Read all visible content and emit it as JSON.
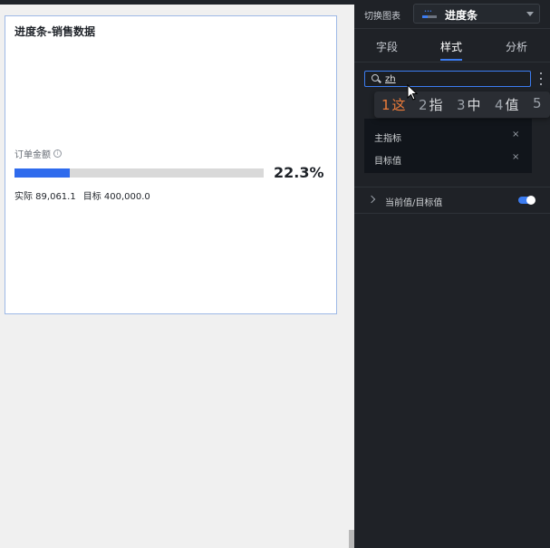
{
  "card": {
    "title": "进度条-销售数据",
    "metric_label": "订单金额",
    "info_glyph": "i",
    "progress_fraction": 0.223,
    "percent_text": "22.3%",
    "actual_text": "实际 89,061.1",
    "target_text": "目标 400,000.0",
    "colors": {
      "fill": "#2f6bed",
      "track": "#d9d9d9"
    }
  },
  "panel": {
    "switch_label": "切换图表",
    "chart_name": "进度条",
    "chart_icon": "progress-chart-icon",
    "tabs": [
      {
        "label": "字段"
      },
      {
        "label": "样式",
        "active": true
      },
      {
        "label": "分析"
      }
    ],
    "search": {
      "value": "zh"
    },
    "ime_candidates": [
      {
        "num": "1",
        "text": "这"
      },
      {
        "num": "2",
        "text": "指"
      },
      {
        "num": "3",
        "text": "中"
      },
      {
        "num": "4",
        "text": "值"
      },
      {
        "num": "5",
        "text": ""
      }
    ],
    "dropdown_items": [
      {
        "label": "主指标"
      },
      {
        "label": "目标值"
      }
    ],
    "section": {
      "label": "当前值/目标值",
      "toggle_on": true
    },
    "accent": "#3c7cf0"
  }
}
